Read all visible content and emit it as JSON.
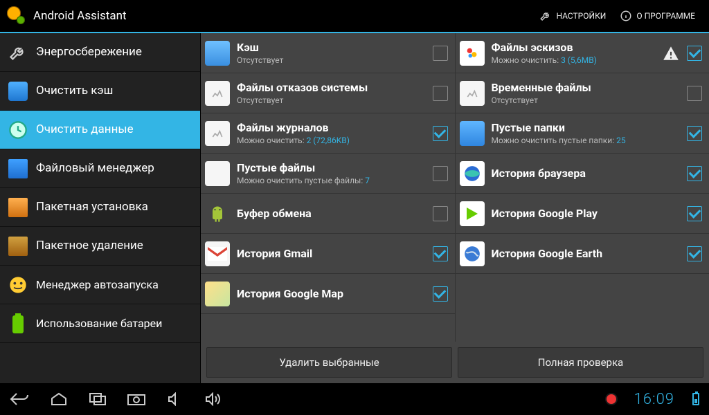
{
  "header": {
    "title": "Android Assistant",
    "settings_label": "НАСТРОЙКИ",
    "about_label": "О ПРОГРАММЕ"
  },
  "sidebar": {
    "items": [
      {
        "icon": "wrench-icon",
        "label": "Энергосбережение",
        "active": false
      },
      {
        "icon": "clear-cache-icon",
        "label": "Очистить кэш",
        "active": false
      },
      {
        "icon": "clear-data-icon",
        "label": "Очистить данные",
        "active": true
      },
      {
        "icon": "file-manager-icon",
        "label": "Файловый менеджер",
        "active": false
      },
      {
        "icon": "batch-install-icon",
        "label": "Пакетная установка",
        "active": false
      },
      {
        "icon": "batch-uninstall-icon",
        "label": "Пакетное удаление",
        "active": false
      },
      {
        "icon": "startup-manager-icon",
        "label": "Менеджер автозапуска",
        "active": false
      },
      {
        "icon": "battery-usage-icon",
        "label": "Использование батареи",
        "active": false
      }
    ]
  },
  "columns": {
    "left": [
      {
        "icon": "cache-icon",
        "title": "Кэш",
        "sub_prefix": "Отсутствует",
        "sub_value": "",
        "checked": false
      },
      {
        "icon": "file-icon",
        "title": "Файлы отказов системы",
        "sub_prefix": "Отсутствует",
        "sub_value": "",
        "checked": false
      },
      {
        "icon": "file-icon",
        "title": "Файлы журналов",
        "sub_prefix": "Можно очистить: ",
        "sub_value": "2 (72,86KB)",
        "checked": true
      },
      {
        "icon": "file-icon",
        "title": "Пустые файлы",
        "sub_prefix": "Можно очистить пустые файлы: ",
        "sub_value": "7",
        "checked": false
      },
      {
        "icon": "android-icon",
        "title": "Буфер обмена",
        "sub_prefix": "",
        "sub_value": "",
        "checked": false
      },
      {
        "icon": "gmail-icon",
        "title": "История Gmail",
        "sub_prefix": "",
        "sub_value": "",
        "checked": true
      },
      {
        "icon": "maps-icon",
        "title": "История Google Map",
        "sub_prefix": "",
        "sub_value": "",
        "checked": true
      }
    ],
    "right": [
      {
        "icon": "thumbs-icon",
        "title": "Файлы эскизов",
        "sub_prefix": "Можно очистить: ",
        "sub_value": "3 (5,6MB)",
        "checked": true,
        "warn": true
      },
      {
        "icon": "file-icon",
        "title": "Временные файлы",
        "sub_prefix": "Отсутствует",
        "sub_value": "",
        "checked": false
      },
      {
        "icon": "folder-icon",
        "title": "Пустые папки",
        "sub_prefix": "Можно очистить пустые папки: ",
        "sub_value": "25",
        "checked": true
      },
      {
        "icon": "browser-icon",
        "title": "История браузера",
        "sub_prefix": "",
        "sub_value": "",
        "checked": true
      },
      {
        "icon": "play-icon",
        "title": "История Google Play",
        "sub_prefix": "",
        "sub_value": "",
        "checked": true
      },
      {
        "icon": "earth-icon",
        "title": "История Google Earth",
        "sub_prefix": "",
        "sub_value": "",
        "checked": true
      }
    ]
  },
  "actions": {
    "delete_selected": "Удалить выбранные",
    "full_check": "Полная проверка"
  },
  "navbar": {
    "clock": "16:09"
  }
}
